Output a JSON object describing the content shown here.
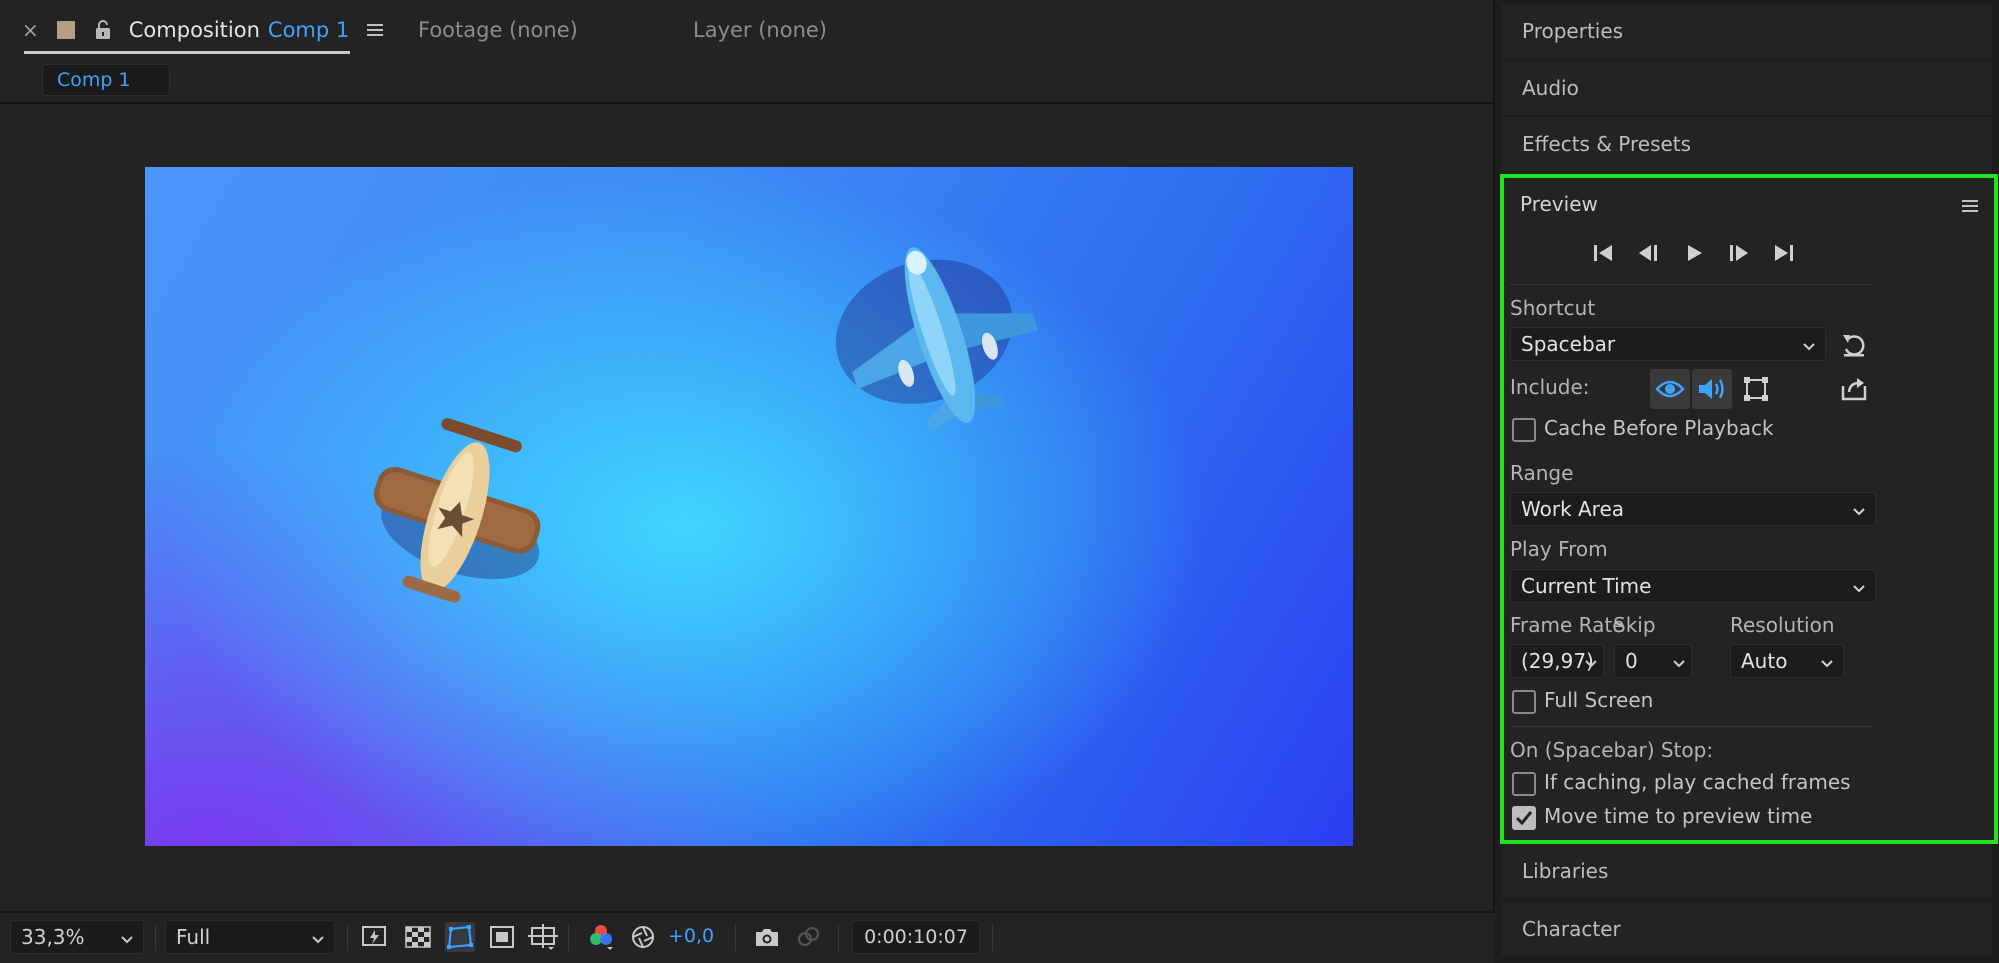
{
  "composition_panel": {
    "tabs": {
      "composition_label": "Composition",
      "composition_name": "Comp 1",
      "footage": "Footage (none)",
      "layer": "Layer (none)"
    },
    "breadcrumb": "Comp 1",
    "toolbar": {
      "zoom": "33,3%",
      "resolution": "Full",
      "exposure": "+0,0",
      "timecode": "0:00:10:07"
    }
  },
  "right_panels": {
    "properties": "Properties",
    "audio": "Audio",
    "effects_presets": "Effects & Presets",
    "libraries": "Libraries",
    "character": "Character"
  },
  "preview": {
    "title": "Preview",
    "shortcut_label": "Shortcut",
    "shortcut_value": "Spacebar",
    "include_label": "Include:",
    "cache_before_playback": "Cache Before Playback",
    "range_label": "Range",
    "range_value": "Work Area",
    "play_from_label": "Play From",
    "play_from_value": "Current Time",
    "frame_rate_label": "Frame Rate",
    "frame_rate_value": "(29,97)",
    "skip_label": "Skip",
    "skip_value": "0",
    "resolution_label": "Resolution",
    "resolution_value": "Auto",
    "full_screen": "Full Screen",
    "stop_label": "On (Spacebar) Stop:",
    "if_caching": "If caching, play cached frames",
    "move_time": "Move time to preview time",
    "checkbox_state": {
      "cache_before_playback": false,
      "full_screen": false,
      "if_caching": false,
      "move_time": true
    }
  },
  "colors": {
    "accent_blue": "#3ea2ff",
    "highlight_green": "#21e21e",
    "panel_bg": "#232323"
  },
  "icons": {
    "close": "close-icon",
    "lock": "lock-icon",
    "menu": "hamburger-menu-icon",
    "first_frame": "first-frame-icon",
    "previous_frame": "previous-frame-icon",
    "play": "play-icon",
    "next_frame": "next-frame-icon",
    "last_frame": "last-frame-icon",
    "reset": "reset-icon",
    "video": "eye-icon",
    "audio": "speaker-icon",
    "overlays": "overlays-icon",
    "export": "export-icon"
  }
}
